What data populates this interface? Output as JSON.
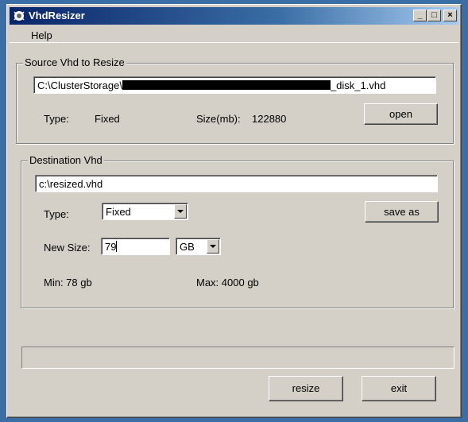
{
  "window": {
    "title": "VhdResizer"
  },
  "titlebar_buttons": {
    "minimize": "_",
    "maximize": "□",
    "close": "×"
  },
  "menu": {
    "items": [
      "Help"
    ]
  },
  "source": {
    "group_label": "Source Vhd to Resize",
    "path_prefix": "C:\\ClusterStorage\\",
    "path_suffix": "_disk_1.vhd",
    "type_label": "Type:",
    "type_value": "Fixed",
    "size_label": "Size(mb):",
    "size_value": "122880",
    "open_button": "open"
  },
  "destination": {
    "group_label": "Destination Vhd",
    "path": "c:\\resized.vhd",
    "type_label": "Type:",
    "type_selected": "Fixed",
    "save_as_button": "save as",
    "new_size_label": "New Size:",
    "new_size_value": "79",
    "unit_selected": "GB",
    "min_text": "Min: 78 gb",
    "max_text": "Max: 4000 gb"
  },
  "actions": {
    "resize_button": "resize",
    "exit_button": "exit"
  },
  "colors": {
    "titlebar_start": "#0a246a",
    "titlebar_end": "#a6caf0",
    "face": "#d4d0c8",
    "desktop": "#3a6ea5"
  }
}
